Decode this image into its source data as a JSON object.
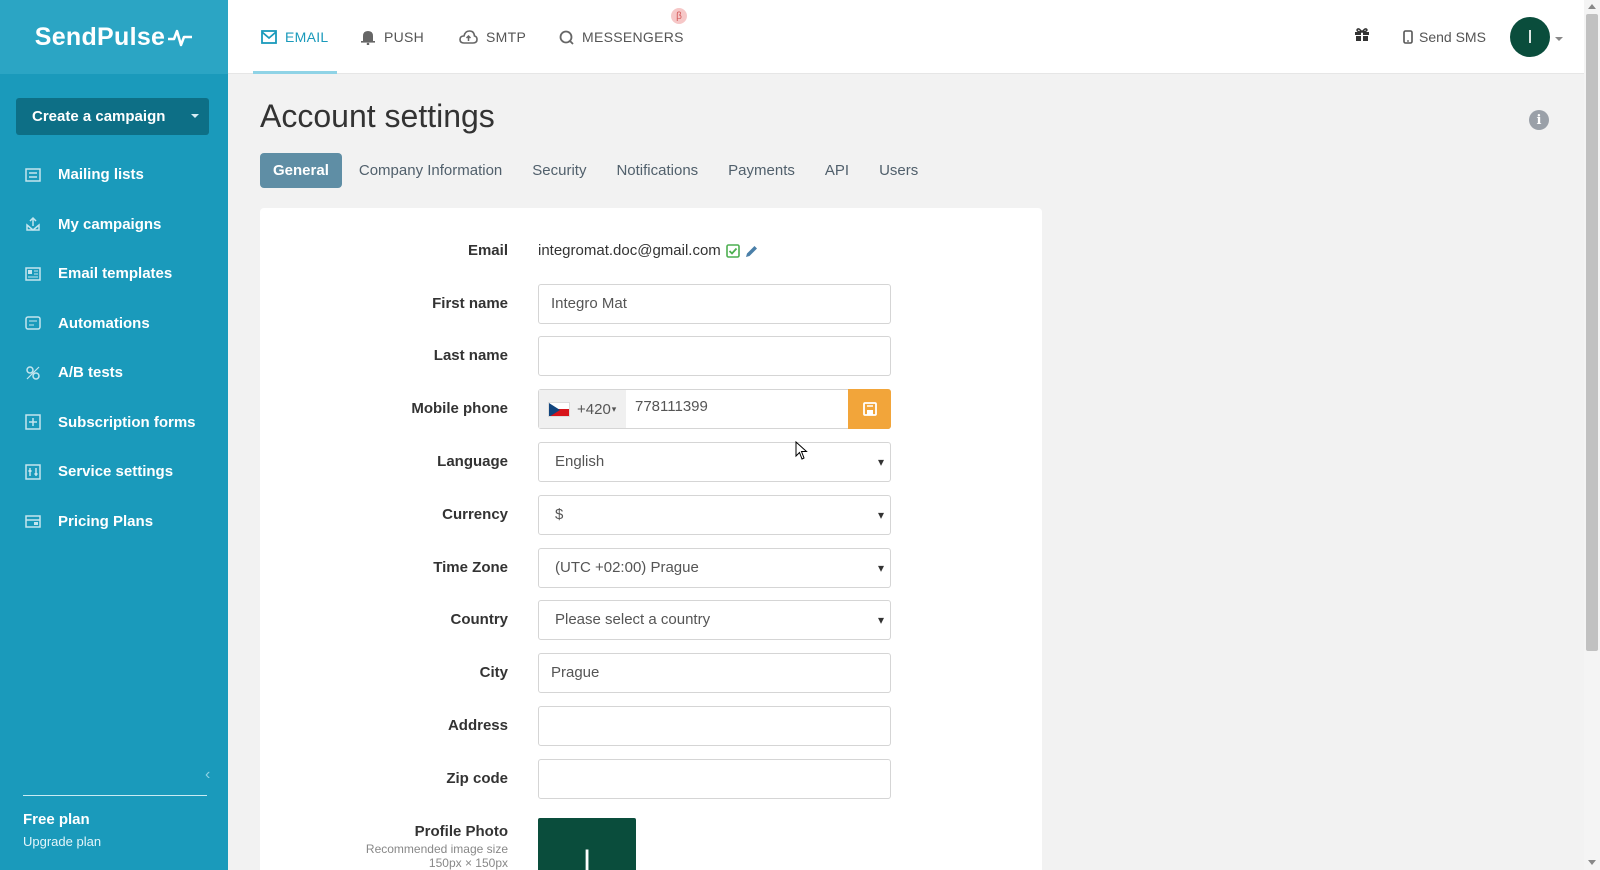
{
  "app": {
    "logo": "SendPulse",
    "create_campaign": "Create a campaign",
    "plan_name": "Free plan",
    "upgrade_label": "Upgrade plan"
  },
  "sidebar": {
    "items": [
      {
        "label": "Mailing lists",
        "icon": "list-icon"
      },
      {
        "label": "My campaigns",
        "icon": "campaign-icon"
      },
      {
        "label": "Email templates",
        "icon": "template-icon"
      },
      {
        "label": "Automations",
        "icon": "automation-icon"
      },
      {
        "label": "A/B tests",
        "icon": "ab-test-icon"
      },
      {
        "label": "Subscription forms",
        "icon": "form-icon"
      },
      {
        "label": "Service settings",
        "icon": "settings-icon"
      },
      {
        "label": "Pricing Plans",
        "icon": "pricing-icon"
      }
    ]
  },
  "topnav": {
    "tabs": [
      {
        "label": "EMAIL",
        "icon": "envelope-icon",
        "active": true
      },
      {
        "label": "PUSH",
        "icon": "bell-icon",
        "active": false
      },
      {
        "label": "SMTP",
        "icon": "cloud-upload-icon",
        "active": false
      },
      {
        "label": "MESSENGERS",
        "icon": "chat-icon",
        "active": false
      }
    ],
    "beta_badge": "β",
    "send_sms": "Send SMS",
    "avatar_initial": "I"
  },
  "page": {
    "title": "Account settings",
    "tabs": [
      "General",
      "Company Information",
      "Security",
      "Notifications",
      "Payments",
      "API",
      "Users"
    ],
    "active_tab": "General"
  },
  "form": {
    "email": {
      "label": "Email",
      "value": "integromat.doc@gmail.com"
    },
    "first_name": {
      "label": "First name",
      "value": "Integro Mat"
    },
    "last_name": {
      "label": "Last name",
      "value": ""
    },
    "mobile_phone": {
      "label": "Mobile phone",
      "country_code": "+420",
      "value": "778111399"
    },
    "language": {
      "label": "Language",
      "value": "English"
    },
    "currency": {
      "label": "Currency",
      "value": "$"
    },
    "time_zone": {
      "label": "Time Zone",
      "value": "(UTC +02:00) Prague"
    },
    "country": {
      "label": "Country",
      "value": "Please select a country"
    },
    "city": {
      "label": "City",
      "value": "Prague"
    },
    "address": {
      "label": "Address",
      "value": ""
    },
    "zip_code": {
      "label": "Zip code",
      "value": ""
    },
    "profile_photo": {
      "label": "Profile Photo",
      "hint": "Recommended image size",
      "hint2": "150px × 150px",
      "initial": "I"
    }
  },
  "colors": {
    "sidebar": "#1a9abb",
    "accent": "#1a9abb",
    "active_tab": "#5f8ea5",
    "save_button": "#f2a53a",
    "avatar": "#0a4d3c"
  }
}
